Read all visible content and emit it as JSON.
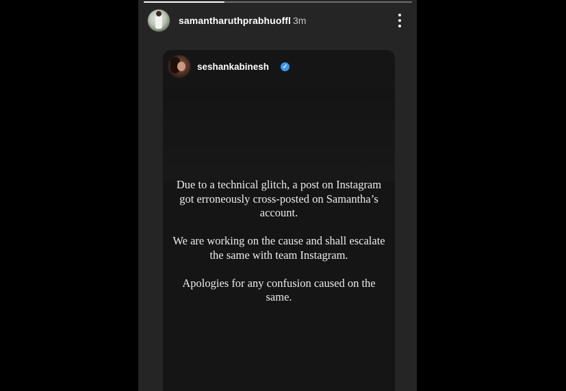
{
  "story": {
    "progress": 0.3,
    "author": {
      "username": "samantharuthprabhuoffl",
      "time_ago": "3m"
    },
    "more_icon": "more-vertical-icon"
  },
  "shared_post": {
    "author": {
      "username": "seshankabinesh",
      "verified": true,
      "verified_icon": "verified-badge-icon"
    },
    "message": [
      "Due to a technical glitch, a post on Instagram got erroneously cross-posted on Samantha’s account.",
      "We are working on the cause and shall escalate the same with team Instagram.",
      "Apologies for any confusion caused on the same."
    ]
  },
  "colors": {
    "background": "#000000",
    "story_background": "#252525",
    "card_background": "#151515",
    "verified_blue": "#3897f0",
    "text": "#ececec"
  }
}
